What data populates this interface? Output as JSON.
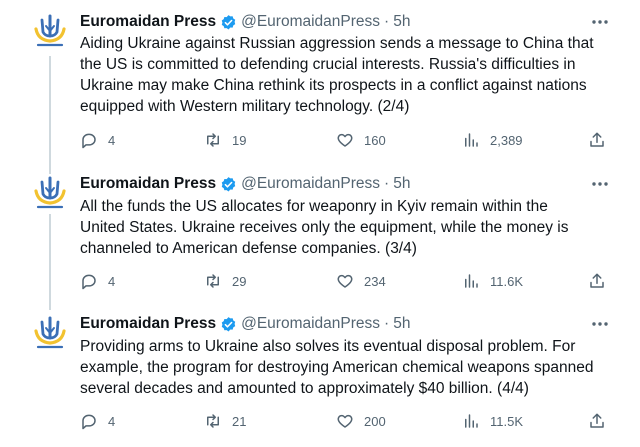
{
  "tweets": [
    {
      "name": "Euromaidan Press",
      "handle": "@EuromaidanPress",
      "sep": "·",
      "time": "5h",
      "lines": [
        "Aiding Ukraine against Russian aggression sends a message to China that",
        "the US is committed to defending crucial interests. Russia's difficulties in",
        "Ukraine may make China rethink its prospects in a conflict against nations",
        "equipped with Western military technology. (2/4)"
      ],
      "replies": "4",
      "reposts": "19",
      "likes": "160",
      "views": "2,389"
    },
    {
      "name": "Euromaidan Press",
      "handle": "@EuromaidanPress",
      "sep": "·",
      "time": "5h",
      "lines": [
        "All the funds the US allocates for weaponry in Kyiv remain within the",
        "United States. Ukraine receives only the equipment, while the money is",
        "channeled to American defense companies. (3/4)"
      ],
      "replies": "4",
      "reposts": "29",
      "likes": "234",
      "views": "11.6K"
    },
    {
      "name": "Euromaidan Press",
      "handle": "@EuromaidanPress",
      "sep": "·",
      "time": "5h",
      "lines": [
        "Providing arms to Ukraine also solves its eventual disposal problem. For",
        "example, the program for destroying American chemical weapons spanned",
        "several decades and amounted to approximately $40 billion. (4/4)"
      ],
      "replies": "4",
      "reposts": "21",
      "likes": "200",
      "views": "11.5K"
    }
  ],
  "icons": {
    "avatar": "trident-logo-icon",
    "verified": "verified-badge-icon",
    "more": "more-dots-icon",
    "reply": "reply-icon",
    "repost": "repost-icon",
    "like": "heart-icon",
    "views": "views-icon",
    "share": "share-icon"
  },
  "colors": {
    "verified": "#1d9bf0",
    "logo_blue": "#3b6fb6",
    "logo_yellow": "#f2c230",
    "muted": "#536471",
    "thread_line": "#cfd9de"
  }
}
